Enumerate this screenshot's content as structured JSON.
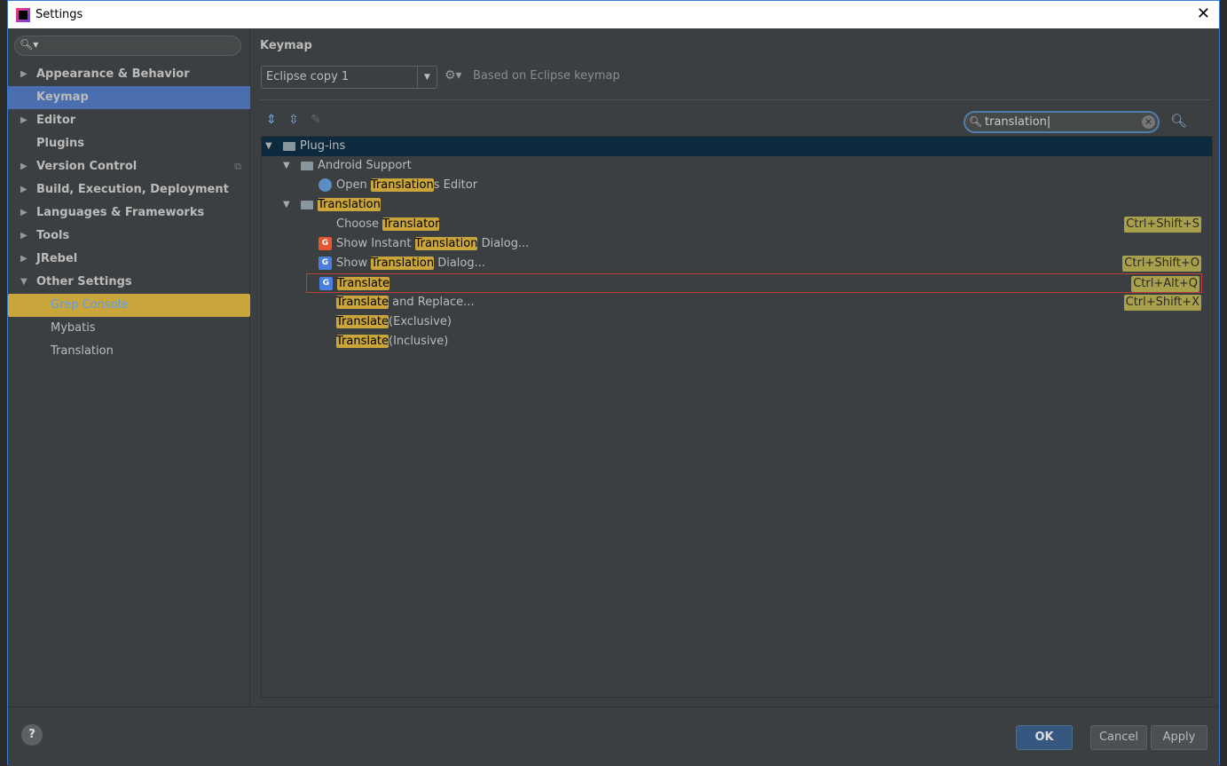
{
  "window": {
    "title": "Settings",
    "close": "✕"
  },
  "sidebar": {
    "search_placeholder": "",
    "items": [
      {
        "label": "Appearance & Behavior",
        "arrow": "▶"
      },
      {
        "label": "Keymap",
        "selected": true
      },
      {
        "label": "Editor",
        "arrow": "▶"
      },
      {
        "label": "Plugins"
      },
      {
        "label": "Version Control",
        "arrow": "▶"
      },
      {
        "label": "Build, Execution, Deployment",
        "arrow": "▶"
      },
      {
        "label": "Languages & Frameworks",
        "arrow": "▶"
      },
      {
        "label": "Tools",
        "arrow": "▶"
      },
      {
        "label": "JRebel",
        "arrow": "▶"
      },
      {
        "label": "Other Settings",
        "arrow": "▼"
      },
      {
        "label": "Grep Console"
      },
      {
        "label": "Mybatis"
      },
      {
        "label": "Translation"
      }
    ]
  },
  "keymap": {
    "title": "Keymap",
    "selected": "Eclipse copy 1",
    "based_on": "Based on Eclipse keymap",
    "search_value": "translation"
  },
  "tree": [
    {
      "pre": "",
      "hl": "",
      "post": "Plug-ins"
    },
    {
      "pre": "",
      "hl": "",
      "post": "Android Support"
    },
    {
      "pre": "Open ",
      "hl": "Translation",
      "post": "s Editor"
    },
    {
      "pre": "",
      "hl": "Translation",
      "post": ""
    },
    {
      "pre": "Choose ",
      "hl": "Translator",
      "post": "",
      "shortcut": "Ctrl+Shift+S"
    },
    {
      "pre": "Show Instant ",
      "hl": "Translation",
      "post": " Dialog..."
    },
    {
      "pre": "Show ",
      "hl": "Translation",
      "post": " Dialog...",
      "shortcut": "Ctrl+Shift+O"
    },
    {
      "pre": "",
      "hl": "Translate",
      "post": "",
      "shortcut": "Ctrl+Alt+Q"
    },
    {
      "pre": "",
      "hl": "Translate",
      "post": " and Replace...",
      "shortcut": "Ctrl+Shift+X"
    },
    {
      "pre": "",
      "hl": "Translate",
      "post": "(Exclusive)"
    },
    {
      "pre": "",
      "hl": "Translate",
      "post": "(Inclusive)"
    }
  ],
  "buttons": {
    "ok": "OK",
    "cancel": "Cancel",
    "apply": "Apply",
    "help": "?"
  },
  "colors": {
    "selection": "#4b6eaf",
    "highlight": "#c9a53c",
    "shortcut": "#a8a04a"
  }
}
